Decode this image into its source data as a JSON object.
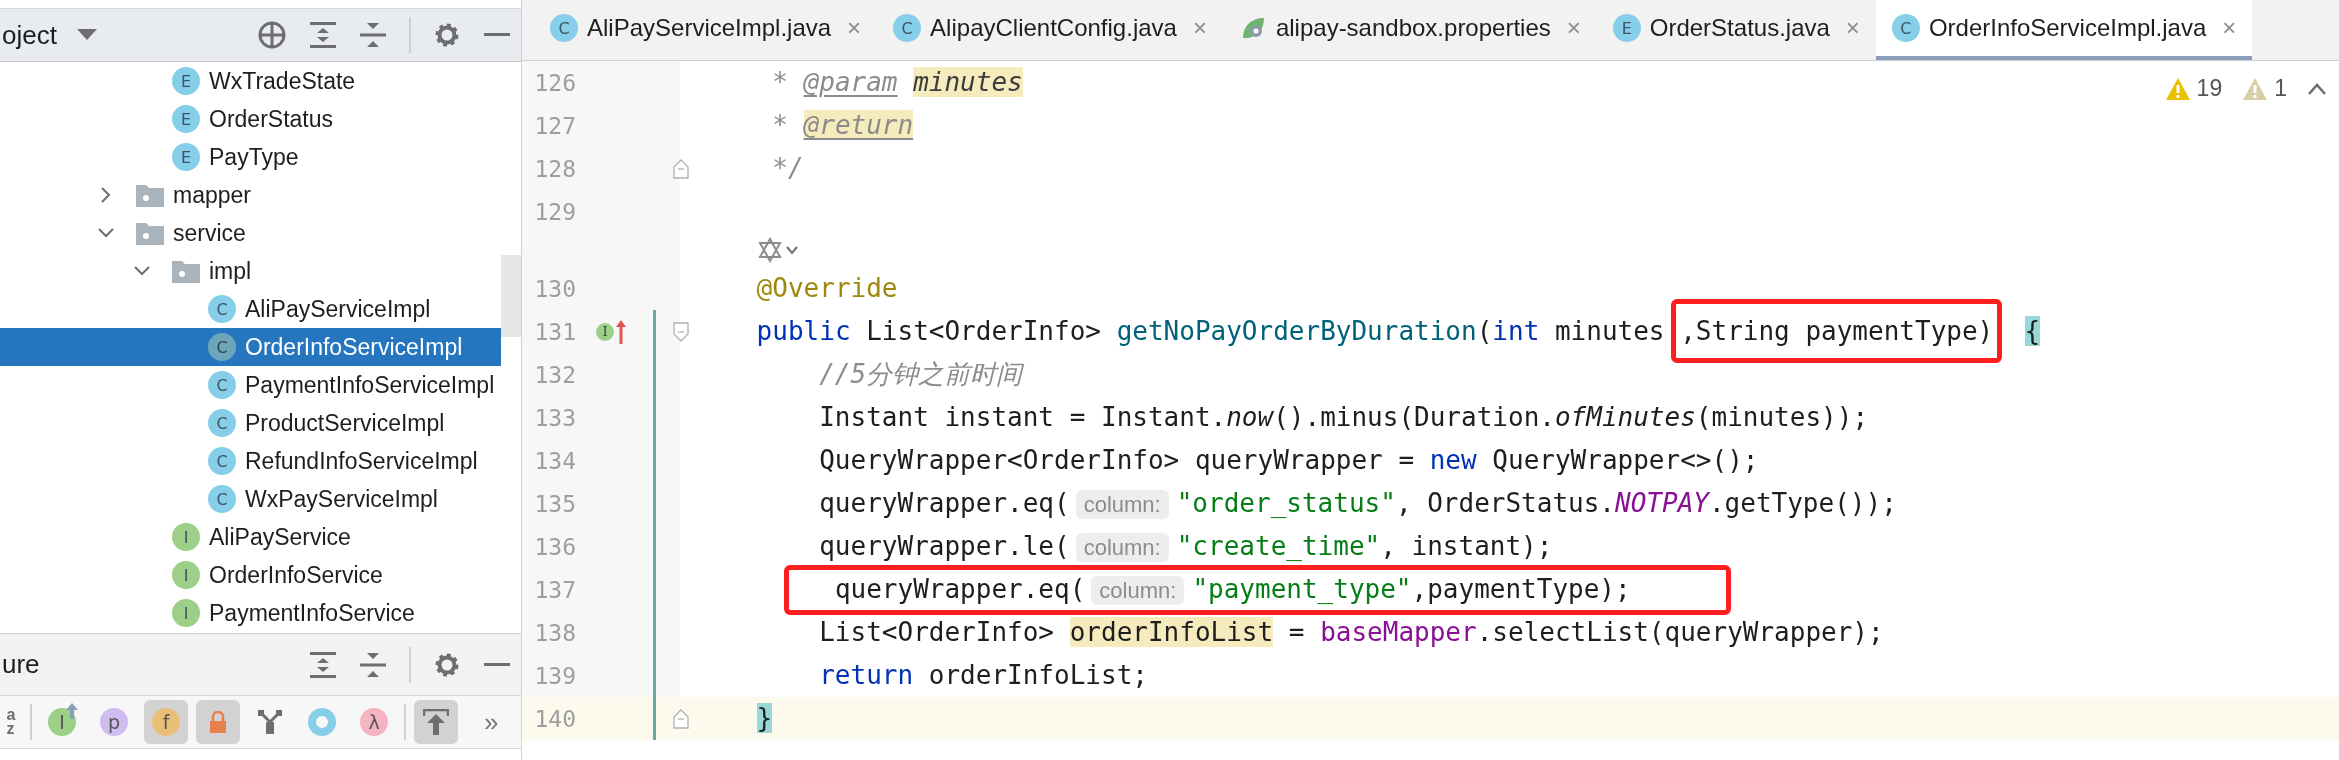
{
  "project_panel": {
    "title": "oject",
    "tree": [
      {
        "kind": "offscreen",
        "children": [
          {
            "label": "WxTradeState",
            "kind": "enum",
            "icon": "E",
            "selected": false
          },
          {
            "label": "OrderStatus",
            "kind": "enum",
            "icon": "E",
            "selected": false
          },
          {
            "label": "PayType",
            "kind": "enum",
            "icon": "E",
            "selected": false
          }
        ]
      },
      {
        "label": "mapper",
        "kind": "folder",
        "expanded": false,
        "selected": false
      },
      {
        "label": "service",
        "kind": "folder",
        "expanded": true,
        "selected": false,
        "children": [
          {
            "label": "impl",
            "kind": "folder",
            "expanded": true,
            "selected": false,
            "children": [
              {
                "label": "AliPayServiceImpl",
                "kind": "class",
                "icon": "C",
                "selected": false
              },
              {
                "label": "OrderInfoServiceImpl",
                "kind": "class",
                "icon": "C",
                "selected": true
              },
              {
                "label": "PaymentInfoServiceImpl",
                "kind": "class",
                "icon": "C",
                "selected": false
              },
              {
                "label": "ProductServiceImpl",
                "kind": "class",
                "icon": "C",
                "selected": false
              },
              {
                "label": "RefundInfoServiceImpl",
                "kind": "class",
                "icon": "C",
                "selected": false
              },
              {
                "label": "WxPayServiceImpl",
                "kind": "class",
                "icon": "C",
                "selected": false
              }
            ]
          },
          {
            "label": "AliPayService",
            "kind": "interface",
            "icon": "I",
            "selected": false
          },
          {
            "label": "OrderInfoService",
            "kind": "interface",
            "icon": "I",
            "selected": false
          },
          {
            "label": "PaymentInfoService",
            "kind": "interface",
            "icon": "I",
            "selected": false
          }
        ]
      }
    ]
  },
  "structure_panel": {
    "title": "ure",
    "toolbar": [
      {
        "kind": "sort",
        "text": "az",
        "pressed": false
      },
      {
        "kind": "divider"
      },
      {
        "kind": "inherited",
        "text": "I",
        "color": "#9ccf88",
        "pressed": false
      },
      {
        "kind": "letter",
        "text": "p",
        "color": "#cfbdf2",
        "pressed": false
      },
      {
        "kind": "letter",
        "text": "f",
        "color": "#e9bf78",
        "pressed": true
      },
      {
        "kind": "lock",
        "pressed": true
      },
      {
        "kind": "fork",
        "pressed": false
      },
      {
        "kind": "ring",
        "color": "#87cfe8",
        "pressed": false
      },
      {
        "kind": "letter",
        "text": "λ",
        "color": "#f4b4c2",
        "pressed": false
      },
      {
        "kind": "divider"
      },
      {
        "kind": "autoscroll",
        "pressed": true
      },
      {
        "kind": "more",
        "text": "»"
      }
    ]
  },
  "tabs": [
    {
      "label": "AliPayServiceImpl.java",
      "kind": "class",
      "icon": "C",
      "close": "×",
      "selected": false
    },
    {
      "label": "AlipayClientConfig.java",
      "kind": "class",
      "icon": "C",
      "close": "×",
      "selected": false
    },
    {
      "label": "alipay-sandbox.properties",
      "kind": "properties",
      "close": "×",
      "selected": false
    },
    {
      "label": "OrderStatus.java",
      "kind": "enum",
      "icon": "E",
      "close": "×",
      "selected": false
    },
    {
      "label": "OrderInfoServiceImpl.java",
      "kind": "class",
      "icon": "C",
      "close": "×",
      "selected": true
    }
  ],
  "inspections": [
    {
      "kind": "warning",
      "count": "19"
    },
    {
      "kind": "weak_warning",
      "count": "1"
    }
  ],
  "lines": [
    {
      "kind": "member_code",
      "number": "126",
      "current": false,
      "changed": false,
      "fold_start": false,
      "fold_end": false,
      "segments": [
        {
          "text": " * ",
          "kind": "doc"
        },
        {
          "text": "@param",
          "kind": "doctag"
        },
        {
          "text": "minutes",
          "kind": "docparam-match"
        }
      ]
    },
    {
      "kind": "member_code",
      "number": "127",
      "current": false,
      "changed": false,
      "fold_start": false,
      "fold_end": false,
      "segments": [
        {
          "text": " * ",
          "kind": "doc"
        },
        {
          "text": "@return",
          "kind": "doctag-match"
        }
      ]
    },
    {
      "kind": "member_code",
      "number": "128",
      "current": false,
      "changed": false,
      "fold_start": false,
      "fold_end": true,
      "segments": [
        {
          "text": " */",
          "kind": "doc"
        }
      ]
    },
    {
      "kind": "member_code",
      "number": "129",
      "current": false,
      "changed": false,
      "fold_start": false,
      "fold_end": false
    },
    {
      "kind": "lens"
    },
    {
      "kind": "member_code",
      "number": "130",
      "current": false,
      "changed": false,
      "fold_start": false,
      "fold_end": false,
      "segments": [
        {
          "text": "@Override",
          "kind": "annotation"
        }
      ]
    },
    {
      "kind": "member_code",
      "number": "131",
      "current": false,
      "changed": true,
      "fold_start": true,
      "fold_end": false,
      "gutter_badge": "I",
      "segments": [
        {
          "text": "public",
          "kind": "keyword"
        },
        {
          "text": " List<OrderInfo> ",
          "kind": "plain"
        },
        {
          "text": "getNoPayOrderByDuration",
          "kind": "method"
        },
        {
          "text": "(",
          "kind": "plain"
        },
        {
          "text": "int",
          "kind": "keyword"
        },
        {
          "text": " minutes",
          "kind": "plain"
        }
      ],
      "boxed": [
        {
          "text": ",String paymentType)",
          "kind": "plain"
        }
      ],
      "after": [
        {
          "text": "{",
          "kind": "brace-match"
        }
      ]
    },
    {
      "kind": "body_code",
      "number": "132",
      "current": false,
      "changed": true,
      "fold_start": false,
      "fold_end": false,
      "segments": [
        {
          "text": "//5分钟之前时间",
          "kind": "comment"
        }
      ]
    },
    {
      "kind": "body_code",
      "number": "133",
      "current": false,
      "changed": true,
      "fold_start": false,
      "fold_end": false,
      "segments": [
        {
          "text": "Instant instant = Instant.",
          "kind": "plain"
        },
        {
          "text": "now",
          "kind": "italic"
        },
        {
          "text": "().minus(Duration.",
          "kind": "plain"
        },
        {
          "text": "ofMinutes",
          "kind": "italic"
        },
        {
          "text": "(minutes));",
          "kind": "plain"
        }
      ]
    },
    {
      "kind": "body_code",
      "number": "134",
      "current": false,
      "changed": true,
      "fold_start": false,
      "fold_end": false,
      "segments": [
        {
          "text": "QueryWrapper<OrderInfo> queryWrapper = ",
          "kind": "plain"
        },
        {
          "text": "new",
          "kind": "keyword"
        },
        {
          "text": " QueryWrapper<>();",
          "kind": "plain"
        }
      ]
    },
    {
      "kind": "body_code",
      "number": "135",
      "current": false,
      "changed": true,
      "fold_start": false,
      "fold_end": false,
      "segments": [
        {
          "text": "queryWrapper.eq(",
          "kind": "plain"
        },
        {
          "text": "column:",
          "kind": "hint"
        },
        {
          "text": "\"order_status\"",
          "kind": "string"
        },
        {
          "text": ", OrderStatus.",
          "kind": "plain"
        },
        {
          "text": "NOTPAY",
          "kind": "static"
        },
        {
          "text": ".getType());",
          "kind": "plain"
        }
      ]
    },
    {
      "kind": "body_code",
      "number": "136",
      "current": false,
      "changed": true,
      "fold_start": false,
      "fold_end": false,
      "segments": [
        {
          "text": "queryWrapper.le(",
          "kind": "plain"
        },
        {
          "text": "column:",
          "kind": "hint"
        },
        {
          "text": "\"create_time\"",
          "kind": "string"
        },
        {
          "text": ", instant);",
          "kind": "plain"
        }
      ]
    },
    {
      "kind": "body_code",
      "number": "137",
      "current": false,
      "changed": true,
      "fold_start": false,
      "fold_end": false,
      "boxed": [
        {
          "text": "queryWrapper.eq(",
          "kind": "plain"
        },
        {
          "text": "column:",
          "kind": "hint"
        },
        {
          "text": "\"payment_type\"",
          "kind": "string"
        },
        {
          "text": ",paymentType);",
          "kind": "plain"
        }
      ]
    },
    {
      "kind": "body_code",
      "number": "138",
      "current": false,
      "changed": true,
      "fold_start": false,
      "fold_end": false,
      "segments": [
        {
          "text": "List<OrderInfo> ",
          "kind": "plain"
        },
        {
          "text": "orderInfoList",
          "kind": "var-match"
        },
        {
          "text": " = ",
          "kind": "plain"
        },
        {
          "text": "baseMapper",
          "kind": "field"
        },
        {
          "text": ".selectList(queryWrapper);",
          "kind": "plain"
        }
      ]
    },
    {
      "kind": "body_code",
      "number": "139",
      "current": false,
      "changed": true,
      "fold_start": false,
      "fold_end": false,
      "segments": [
        {
          "text": "return",
          "kind": "keyword"
        },
        {
          "text": " orderInfoList;",
          "kind": "plain"
        }
      ]
    },
    {
      "kind": "member_code",
      "number": "140",
      "current": true,
      "changed": true,
      "fold_start": false,
      "fold_end": true,
      "segments": [
        {
          "text": "}",
          "kind": "brace-match"
        }
      ]
    }
  ]
}
